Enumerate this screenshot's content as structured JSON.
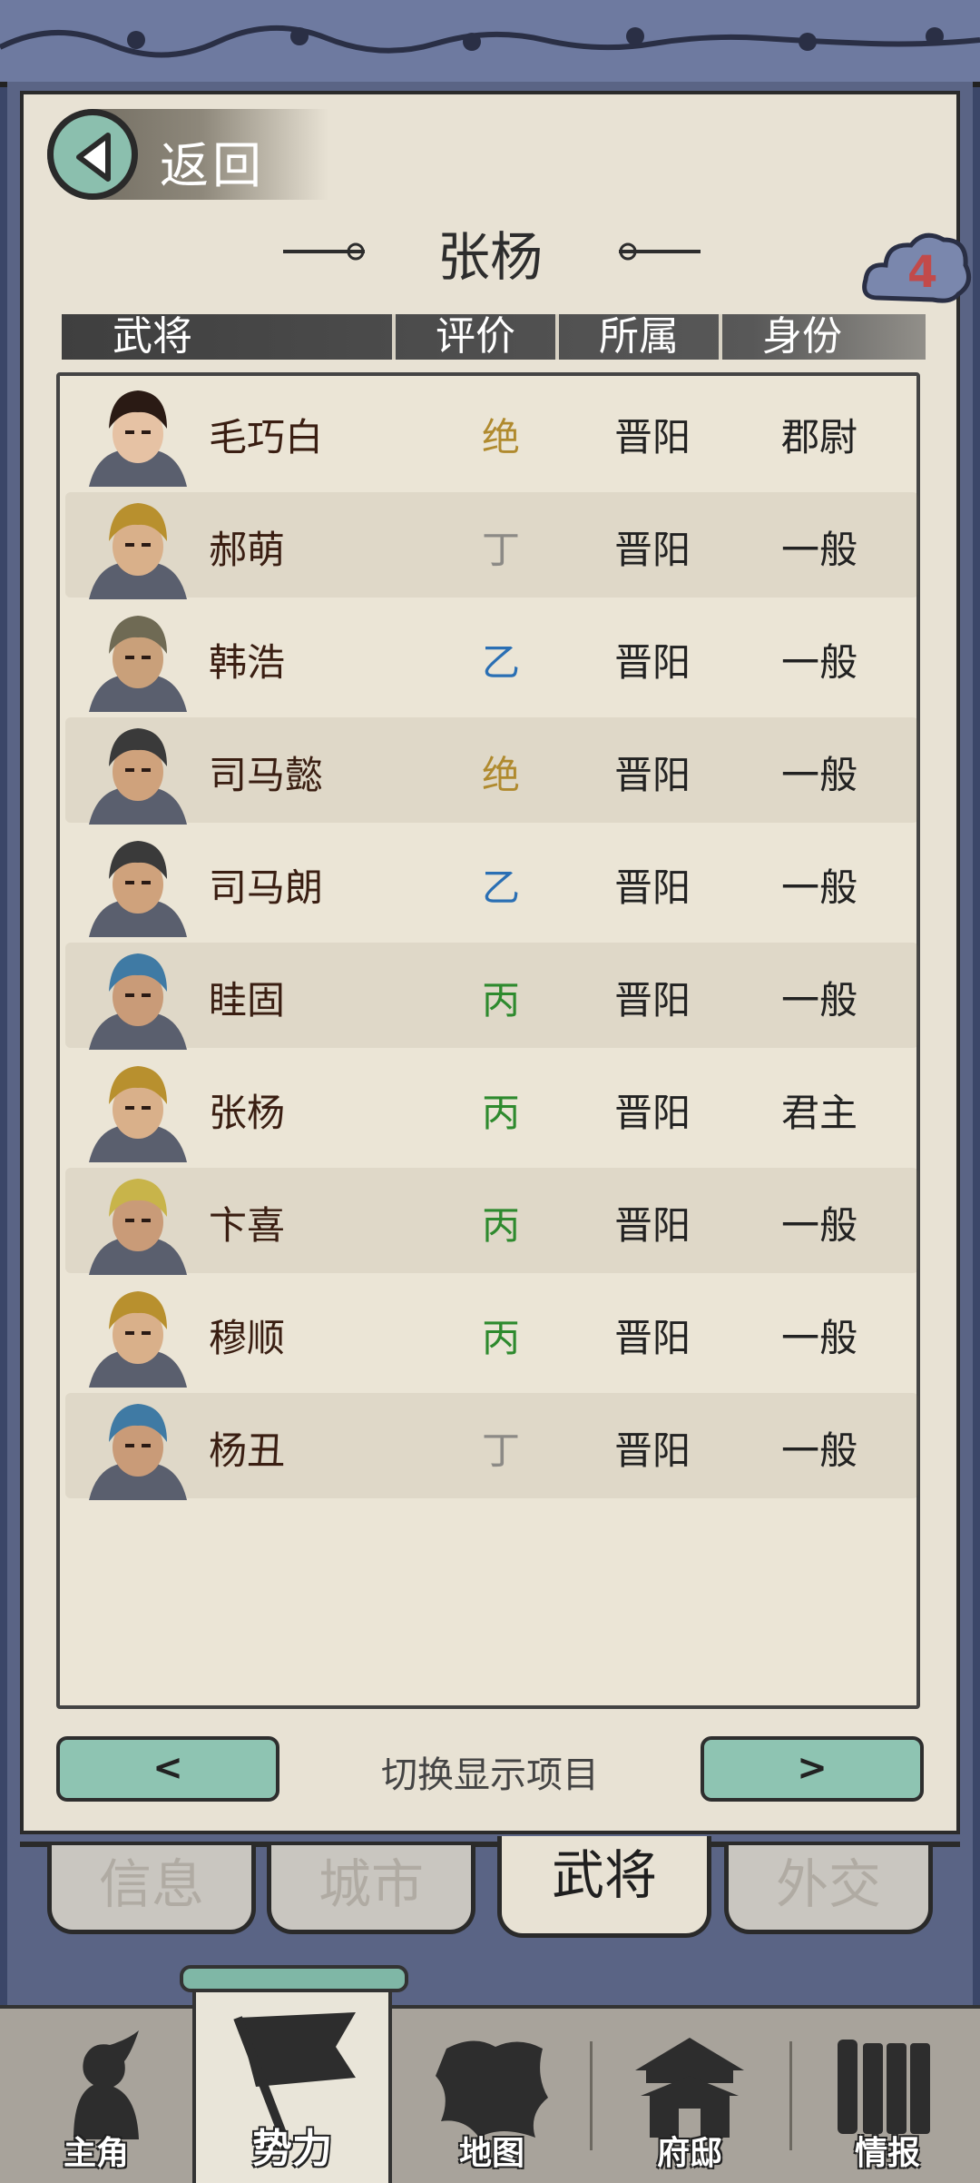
{
  "nav": {
    "back_label": "返回"
  },
  "title": "张杨",
  "badge": {
    "count": "4"
  },
  "table": {
    "headers": [
      "武将",
      "评价",
      "所属",
      "身份"
    ],
    "rows": [
      {
        "name": "毛巧白",
        "grade": "绝",
        "grade_color": "#b08a2e",
        "affiliation": "晋阳",
        "status": "郡尉",
        "portrait": "female-portrait"
      },
      {
        "name": "郝萌",
        "grade": "丁",
        "grade_color": "#8c8a86",
        "affiliation": "晋阳",
        "status": "一般",
        "portrait": "gold-helmet-portrait"
      },
      {
        "name": "韩浩",
        "grade": "乙",
        "grade_color": "#2a6fb4",
        "affiliation": "晋阳",
        "status": "一般",
        "portrait": "helmet-portrait"
      },
      {
        "name": "司马懿",
        "grade": "绝",
        "grade_color": "#b08a2e",
        "affiliation": "晋阳",
        "status": "一般",
        "portrait": "official-portrait"
      },
      {
        "name": "司马朗",
        "grade": "乙",
        "grade_color": "#2a6fb4",
        "affiliation": "晋阳",
        "status": "一般",
        "portrait": "official-portrait"
      },
      {
        "name": "眭固",
        "grade": "丙",
        "grade_color": "#2e8a2e",
        "affiliation": "晋阳",
        "status": "一般",
        "portrait": "blue-turban-portrait"
      },
      {
        "name": "张杨",
        "grade": "丙",
        "grade_color": "#2e8a2e",
        "affiliation": "晋阳",
        "status": "君主",
        "portrait": "gold-helmet-portrait"
      },
      {
        "name": "卞喜",
        "grade": "丙",
        "grade_color": "#2e8a2e",
        "affiliation": "晋阳",
        "status": "一般",
        "portrait": "yellow-turban-portrait"
      },
      {
        "name": "穆顺",
        "grade": "丙",
        "grade_color": "#2e8a2e",
        "affiliation": "晋阳",
        "status": "一般",
        "portrait": "gold-helmet-portrait"
      },
      {
        "name": "杨丑",
        "grade": "丁",
        "grade_color": "#8c8a86",
        "affiliation": "晋阳",
        "status": "一般",
        "portrait": "blue-turban-portrait"
      }
    ]
  },
  "switcher": {
    "prev_label": "<",
    "next_label": ">",
    "label": "切换显示项目"
  },
  "tabs": [
    {
      "label": "信息",
      "active": false
    },
    {
      "label": "城市",
      "active": false
    },
    {
      "label": "武将",
      "active": true
    },
    {
      "label": "外交",
      "active": false
    }
  ],
  "bottom_nav": [
    {
      "label": "主角",
      "icon": "warrior-icon",
      "active": false
    },
    {
      "label": "势力",
      "icon": "flag-icon",
      "active": true
    },
    {
      "label": "地图",
      "icon": "map-icon",
      "active": false
    },
    {
      "label": "府邸",
      "icon": "mansion-icon",
      "active": false
    },
    {
      "label": "情报",
      "icon": "scroll-icon",
      "active": false
    }
  ],
  "colors": {
    "accent": "#8ec4b2",
    "paper": "#e8e2d4",
    "frame": "#5a6485",
    "badge": "#c24a4a"
  }
}
